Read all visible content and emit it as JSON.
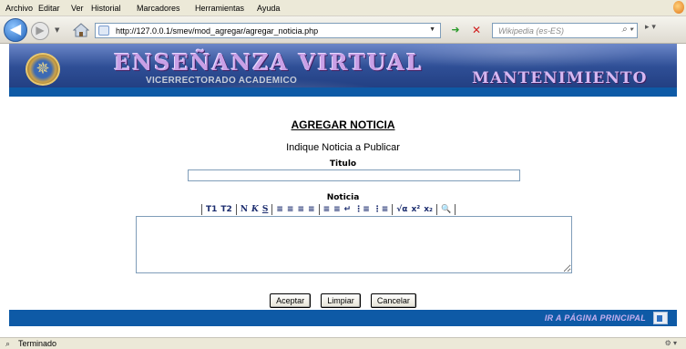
{
  "browser": {
    "menu": [
      "Archivo",
      "Editar",
      "Ver",
      "Historial",
      "Marcadores",
      "Herramientas",
      "Ayuda"
    ],
    "url": "http://127.0.0.1/smev/mod_agregar/agregar_noticia.php",
    "search_placeholder": "Wikipedia (es-ES)",
    "status": "Terminado"
  },
  "banner": {
    "title": "ENSEÑANZA VIRTUAL",
    "subtitle": "VICERRECTORADO ACADEMICO",
    "section": "MANTENIMIENTO"
  },
  "form": {
    "heading": "AGREGAR NOTICIA",
    "instruction": "Indique Noticia a Publicar",
    "title_label": "Titulo",
    "title_value": "",
    "body_label": "Noticia",
    "toolbar": [
      "T1",
      "T2",
      "N",
      "K",
      "S",
      "≡",
      "≡",
      "≡",
      "≡",
      "≡",
      "≡",
      "↵",
      "⋮≡",
      "⋮≡",
      "√α",
      "x²",
      "x₂",
      "🔍"
    ],
    "buttons": {
      "accept": "Aceptar",
      "clear": "Limpiar",
      "cancel": "Cancelar"
    }
  },
  "footer": {
    "home_link": "IR A PÁGINA PRINCIPAL"
  },
  "colors": {
    "accent_blue": "#0e5aa6",
    "banner_text": "#c9a0e6"
  }
}
